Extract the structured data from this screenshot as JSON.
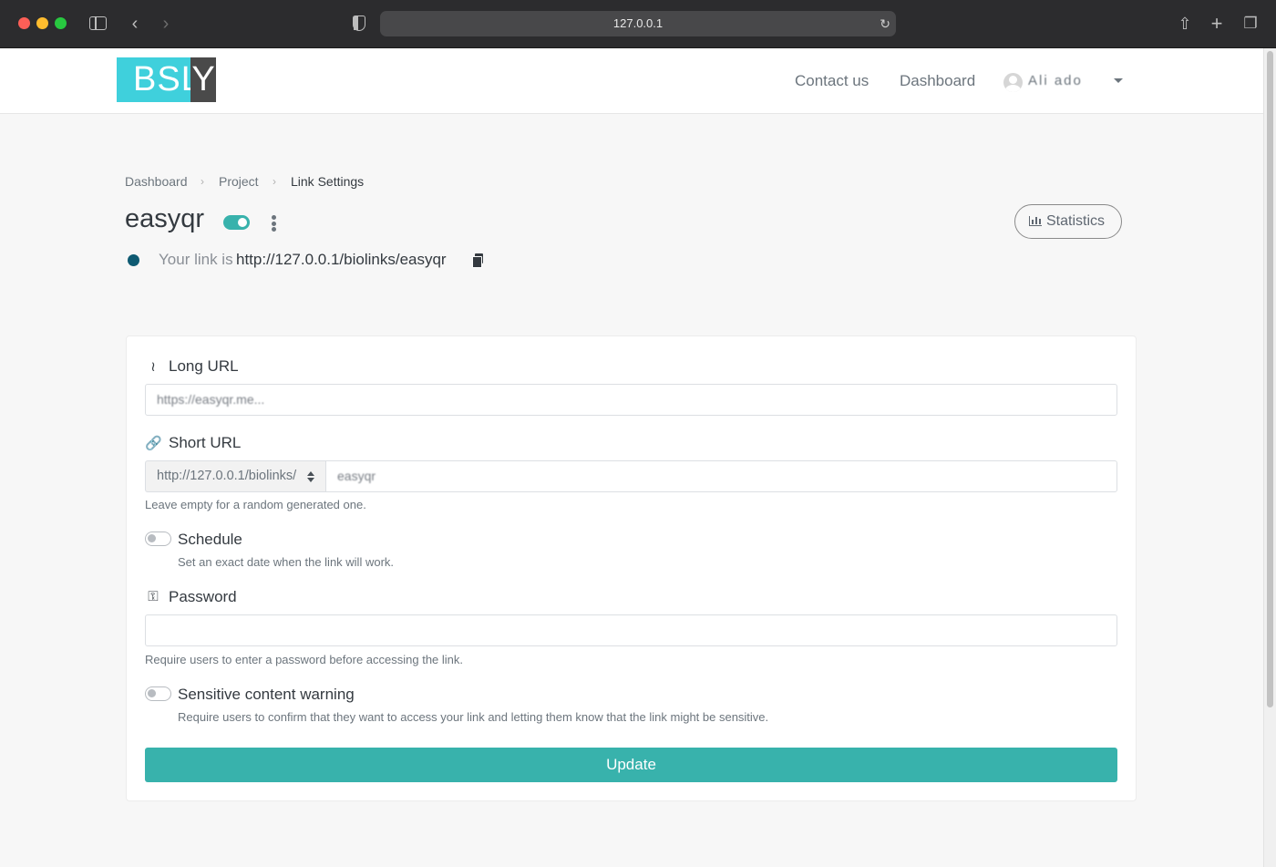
{
  "browser": {
    "address": "127.0.0.1",
    "icons": {
      "sidebar": "sidebar-icon",
      "back": "chevron-left-icon",
      "forward": "chevron-right-icon",
      "shield": "shield-icon",
      "reload": "reload-icon",
      "share": "share-icon",
      "new_tab": "plus-icon",
      "tabs": "tabs-icon"
    }
  },
  "header": {
    "logo": {
      "part1": "BSL",
      "part2": "Y"
    },
    "nav": [
      "Contact us",
      "Dashboard"
    ],
    "user": {
      "name": "Ali ado"
    }
  },
  "breadcrumb": [
    "Dashboard",
    "Project",
    "Link Settings"
  ],
  "page": {
    "title": "easyqr",
    "enabled": true,
    "stats_label": "Statistics",
    "link_prefix": "Your link is",
    "link_url": "http://127.0.0.1/biolinks/easyqr"
  },
  "form": {
    "long_url": {
      "label": "Long URL",
      "value": "https://easyqr.me..."
    },
    "short_url": {
      "label": "Short URL",
      "prefix": "http://127.0.0.1/biolinks/",
      "value": "easyqr",
      "help": "Leave empty for a random generated one."
    },
    "schedule": {
      "label": "Schedule",
      "help": "Set an exact date when the link will work.",
      "on": false
    },
    "password": {
      "label": "Password",
      "value": "",
      "help": "Require users to enter a password before accessing the link."
    },
    "sensitive": {
      "label": "Sensitive content warning",
      "help": "Require users to confirm that they want to access your link and letting them know that the link might be sensitive.",
      "on": false
    },
    "submit": "Update"
  },
  "colors": {
    "accent": "#38b2ac",
    "status_dot": "#0e5a72",
    "logo_cyan": "#3fd0dc",
    "logo_dark": "#4a4a4a"
  }
}
